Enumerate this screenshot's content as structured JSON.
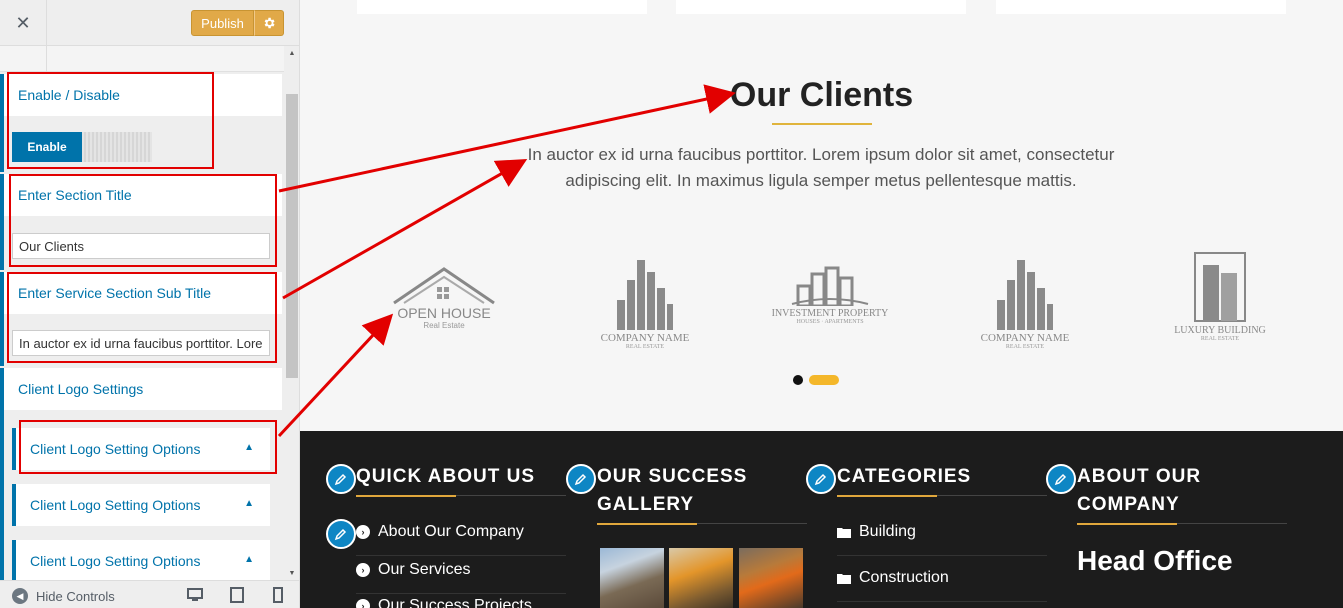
{
  "sidebar": {
    "close_icon": "close-icon",
    "publish_label": "Publish",
    "gear_icon": "gear-icon",
    "enable_disable_title": "Enable / Disable",
    "toggle_on_label": "Enable",
    "section_title_label": "Enter Section Title",
    "section_title_value": "Our Clients",
    "sub_title_label": "Enter Service Section Sub Title",
    "sub_title_value": "In auctor ex id urna faucibus porttitor. Lorem ipsum dolor sit amet, consectetur adipiscing elit.",
    "logo_settings_label": "Client Logo Settings",
    "logo_options": [
      "Client Logo Setting Options",
      "Client Logo Setting Options",
      "Client Logo Setting Options"
    ],
    "hide_controls_label": "Hide Controls"
  },
  "preview": {
    "clients_title": "Our Clients",
    "clients_subtitle": "In auctor ex id urna faucibus porttitor. Lorem ipsum dolor sit amet, consectetur adipiscing elit. In maximus ligula semper metus pellentesque mattis.",
    "logos": [
      {
        "name": "OPEN HOUSE",
        "sub": "Real Estate"
      },
      {
        "name": "COMPANY NAME",
        "sub": "REAL ESTATE"
      },
      {
        "name": "INVESTMENT PROPERTY",
        "sub": "HOUSES · APARTMENTS"
      },
      {
        "name": "COMPANY NAME",
        "sub": "REAL ESTATE"
      },
      {
        "name": "LUXURY BUILDING",
        "sub": "REAL ESTATE"
      }
    ],
    "footer": {
      "col1_heading": "QUICK ABOUT US",
      "col1_links": [
        "About Our Company",
        "Our Services",
        "Our Success Projects"
      ],
      "col2_heading_line1": "OUR SUCCESS",
      "col2_heading_line2": "GALLERY",
      "col3_heading": "CATEGORIES",
      "col3_links": [
        "Building",
        "Construction"
      ],
      "col4_heading_line1": "ABOUT OUR",
      "col4_heading_line2": "COMPANY",
      "head_office": "Head Office"
    }
  },
  "colors": {
    "accent_blue": "#0073aa",
    "publish_orange": "#e1a948",
    "annotation_red": "#e20000",
    "footer_bg": "#1c1c1c",
    "gold": "#e0b43c"
  }
}
